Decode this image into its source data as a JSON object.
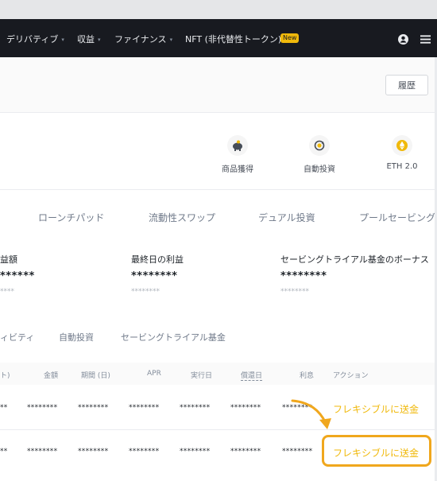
{
  "nav": {
    "items": [
      {
        "label": "デリバティブ",
        "caret": "▾"
      },
      {
        "label": "収益",
        "caret": "▾"
      },
      {
        "label": "ファイナンス",
        "caret": "▾"
      },
      {
        "label": "NFT (非代替性トークン)",
        "caret": ""
      }
    ],
    "new_badge": "New",
    "icons": [
      "user-icon",
      "menu-icon"
    ]
  },
  "header": {
    "history_button": "履歴"
  },
  "shortcuts": [
    {
      "label": "商品獲得",
      "icon": "piggy-bank-icon"
    },
    {
      "label": "自動投資",
      "icon": "auto-invest-icon"
    },
    {
      "label": "ETH 2.0",
      "icon": "ethereum-icon"
    }
  ],
  "product_tabs": [
    "ローンチパッド",
    "流動性スワップ",
    "デュアル投資",
    "プールセービング"
  ],
  "summary": [
    {
      "label": "益額",
      "value": "******",
      "sub": "****"
    },
    {
      "label": "最終日の利益",
      "value": "********",
      "sub": "********"
    },
    {
      "label": "セービングトライアル基金のボーナス",
      "value": "********",
      "sub": "********"
    }
  ],
  "sub_tabs": [
    "ィビティ",
    "自動投資",
    "セービングトライアル基金"
  ],
  "table": {
    "headers": [
      "ト)",
      "金額",
      "期間 (日)",
      "APR",
      "実行日",
      "償還日",
      "利息",
      "アクション"
    ],
    "rows": [
      {
        "cells": [
          "**",
          "********",
          "********",
          "********",
          "********",
          "********",
          "********"
        ],
        "action": "フレキシブルに送金"
      },
      {
        "cells": [
          "**",
          "********",
          "********",
          "********",
          "********",
          "********",
          "********"
        ],
        "action": "フレキシブルに送金"
      }
    ]
  },
  "colors": {
    "accent": "#f0b90b",
    "highlight": "#f0a71d",
    "nav_bg": "#181a20"
  }
}
